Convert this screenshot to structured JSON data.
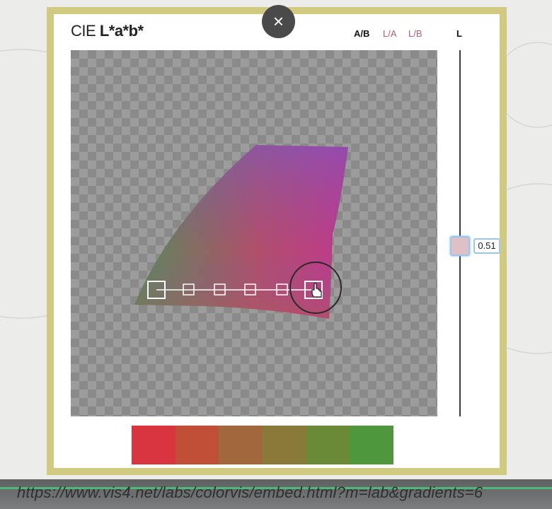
{
  "title": {
    "prefix": "CIE",
    "main": "L*a*b*"
  },
  "tabs": [
    {
      "label": "A/B",
      "active": true
    },
    {
      "label": "L/A",
      "active": false
    },
    {
      "label": "L/B",
      "active": false
    }
  ],
  "slider": {
    "label": "L",
    "value": "0.51",
    "level": 0.51,
    "handle_color": "#dec0c6"
  },
  "close_button": {
    "label": "×"
  },
  "gradient": {
    "steps": 6,
    "colors": [
      "#d8353f",
      "#c04f38",
      "#a2673c",
      "#8a7a3a",
      "#6a8a38",
      "#4f973c"
    ]
  },
  "url": {
    "text": "https://www.vis4.net/labs/colorvis/embed.html?m=lab&gradients=6"
  },
  "colors": {
    "frame": "#d0cb80",
    "tab_inactive": "#b06070",
    "progress": "#4fb878"
  }
}
